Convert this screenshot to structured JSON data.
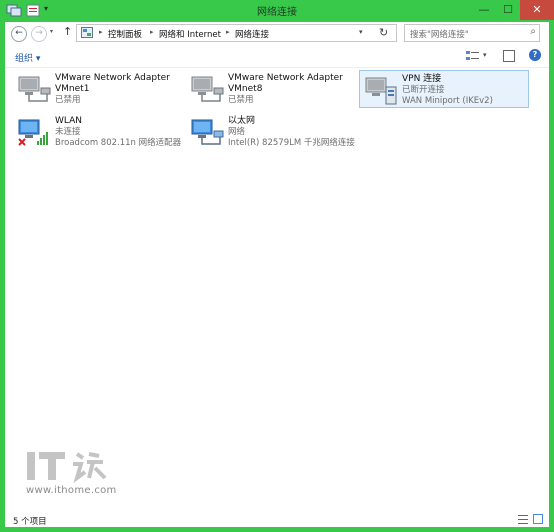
{
  "window": {
    "title": "网络连接",
    "colors": {
      "frame": "#38c94a",
      "close": "#c74a3e",
      "selection": "#e7f2fc"
    }
  },
  "address_bar": {
    "breadcrumbs": [
      "控制面板",
      "网络和 Internet",
      "网络连接"
    ]
  },
  "search": {
    "placeholder": "搜索\"网络连接\""
  },
  "toolbar": {
    "organize_label": "组织 ▾"
  },
  "connections": [
    {
      "name": "VMware Network Adapter",
      "line2": "VMnet1",
      "line3": "已禁用",
      "icon": "network-adapter-disabled-icon"
    },
    {
      "name": "VMware Network Adapter",
      "line2": "VMnet8",
      "line3": "已禁用",
      "icon": "network-adapter-disabled-icon"
    },
    {
      "name": "VPN 连接",
      "line2": "已断开连接",
      "line3": "WAN Miniport (IKEv2)",
      "icon": "vpn-connection-icon",
      "selected": true
    },
    {
      "name": "WLAN",
      "line2": "未连接",
      "line3": "Broadcom 802.11n 网络适配器",
      "icon": "wlan-disconnected-icon"
    },
    {
      "name": "以太网",
      "line2": "网络",
      "line3": "Intel(R) 82579LM 千兆网络连接",
      "icon": "ethernet-icon"
    }
  ],
  "watermark": {
    "logo_text": "IT之家",
    "url": "www.ithome.com"
  },
  "status_bar": {
    "item_count": "5 个项目"
  }
}
